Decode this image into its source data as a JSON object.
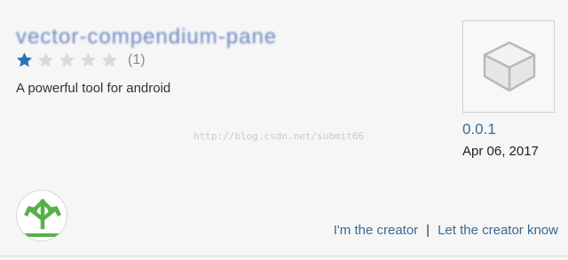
{
  "app": {
    "title": "vector-compendium-pane",
    "rating": {
      "value": 1,
      "max": 5,
      "count_text": "(1)"
    },
    "description": "A powerful tool for android",
    "version": "0.0.1",
    "date": "Apr 06, 2017"
  },
  "watermark": "http://blog.csdn.net/submit66",
  "links": {
    "creator": "I'm the creator",
    "separator": "|",
    "notify": "Let the creator know"
  },
  "colors": {
    "star_filled": "#2a72b8",
    "star_empty": "#dadada",
    "link": "#3a6a96",
    "upload_green": "#59b049"
  },
  "icons": {
    "package": "package-cube-icon",
    "upload": "upload-arrows-icon"
  }
}
